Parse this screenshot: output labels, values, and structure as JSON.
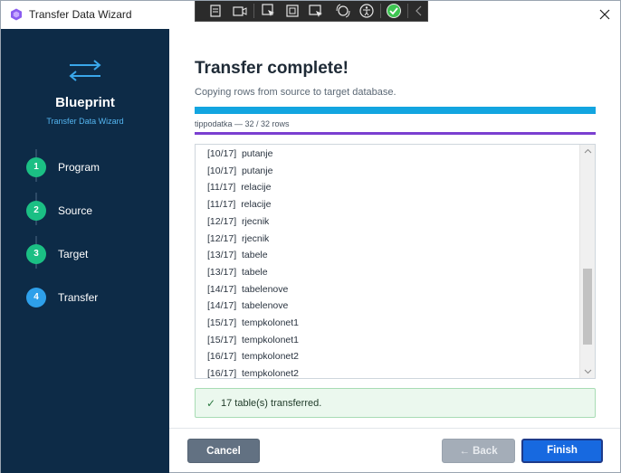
{
  "window": {
    "title": "Transfer Data Wizard",
    "close_icon": "close-icon"
  },
  "sidebar": {
    "brand": "Blueprint",
    "subtitle": "Transfer Data Wizard",
    "steps": [
      {
        "number": "1",
        "label": "Program",
        "state": "done"
      },
      {
        "number": "2",
        "label": "Source",
        "state": "done"
      },
      {
        "number": "3",
        "label": "Target",
        "state": "done"
      },
      {
        "number": "4",
        "label": "Transfer",
        "state": "active"
      }
    ]
  },
  "main": {
    "title": "Transfer complete!",
    "subtitle": "Copying rows from source to target database.",
    "overall_progress": 1.0,
    "table_progress_caption": "tippodatka  —  32 / 32 rows",
    "table_progress": 1.0,
    "log": [
      {
        "step": "[10/17]",
        "table": "putanje"
      },
      {
        "step": "[10/17]",
        "table": "putanje"
      },
      {
        "step": "[11/17]",
        "table": "relacije"
      },
      {
        "step": "[11/17]",
        "table": "relacije"
      },
      {
        "step": "[12/17]",
        "table": "rjecnik"
      },
      {
        "step": "[12/17]",
        "table": "rjecnik"
      },
      {
        "step": "[13/17]",
        "table": "tabele"
      },
      {
        "step": "[13/17]",
        "table": "tabele"
      },
      {
        "step": "[14/17]",
        "table": "tabelenove"
      },
      {
        "step": "[14/17]",
        "table": "tabelenove"
      },
      {
        "step": "[15/17]",
        "table": "tempkolonet1"
      },
      {
        "step": "[15/17]",
        "table": "tempkolonet1"
      },
      {
        "step": "[16/17]",
        "table": "tempkolonet2"
      },
      {
        "step": "[16/17]",
        "table": "tempkolonet2"
      }
    ],
    "success_icon": "✓",
    "success_message": "17 table(s) transferred."
  },
  "footer": {
    "cancel_label": "Cancel",
    "back_label": "← Back",
    "finish_label": "Finish"
  },
  "colors": {
    "sidebar_bg": "#0d2b47",
    "step_done": "#1bbf84",
    "step_active": "#2ea0ea",
    "progress_overall": "#13a5e0",
    "progress_table": "#7a3fd0",
    "finish_button": "#1769e0",
    "success_bg": "#ebf8ee"
  }
}
